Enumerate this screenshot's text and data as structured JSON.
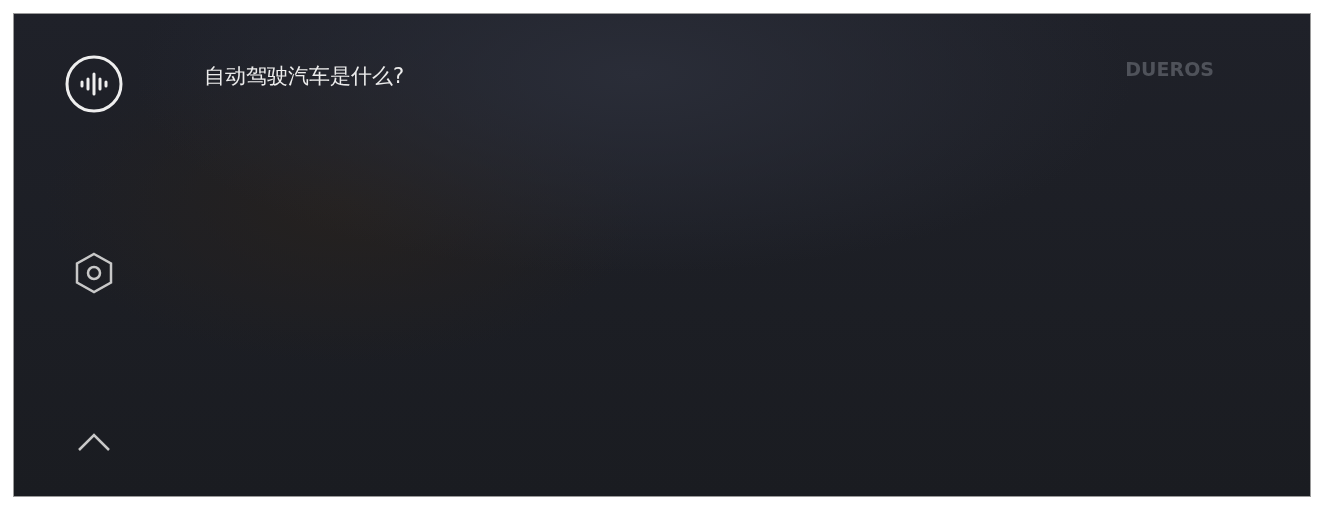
{
  "query": {
    "text": "自动驾驶汽车是什么?"
  },
  "logo": {
    "text": "DUEROS"
  }
}
